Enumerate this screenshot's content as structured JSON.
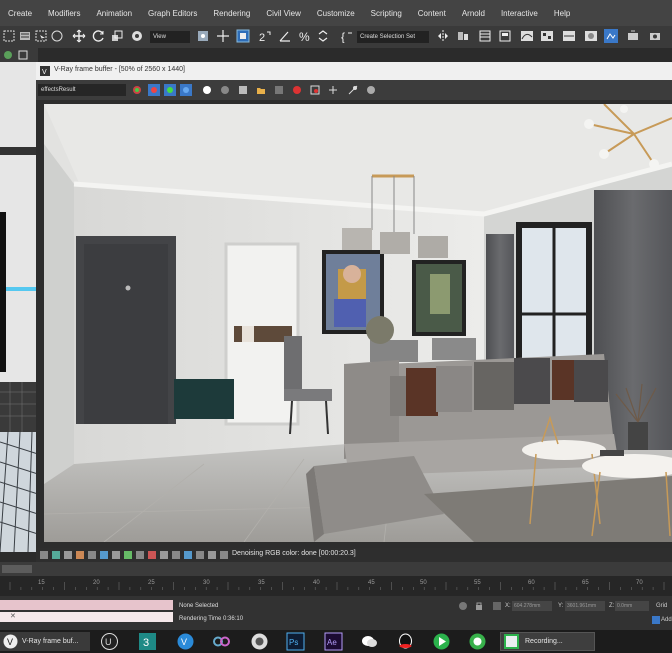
{
  "menu": [
    "Create",
    "Modifiers",
    "Animation",
    "Graph Editors",
    "Rendering",
    "Civil View",
    "Customize",
    "Scripting",
    "Content",
    "Arnold",
    "Interactive",
    "Help"
  ],
  "toolbar": {
    "view_dropdown": "View",
    "selection_set": "Create Selection Set"
  },
  "vfb": {
    "title": "V-Ray frame buffer - [50% of 2560 x 1440]",
    "channel": "effectsResult",
    "status": "Denoising RGB color: done [00:00:20.3]"
  },
  "timeline": {
    "ticks": [
      15,
      20,
      25,
      30,
      35,
      40,
      45,
      50,
      55,
      60,
      65,
      70
    ]
  },
  "status_panel": {
    "selection": "None Selected",
    "rendering_time": "Rendering Time  0:36:10",
    "close_glyph": "✕",
    "x_label": "X:",
    "x_value": "604.278mm",
    "y_label": "Y:",
    "y_value": "3601.961mm",
    "z_label": "Z:",
    "z_value": "0.0mm",
    "grid_label": "Grid",
    "add_label": "Add"
  },
  "taskbar": {
    "vfb_task": "V-Ray frame buf...",
    "recording_task": "Recording..."
  },
  "colors": {
    "accent_blue": "#3a78c8",
    "menubar": "#444444",
    "viewport_wire": "#55c8f0"
  }
}
